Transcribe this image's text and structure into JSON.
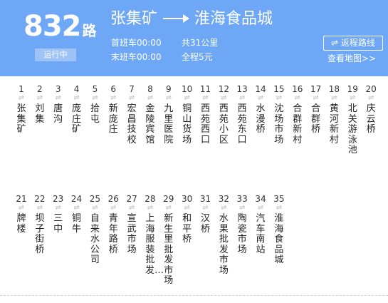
{
  "route": {
    "number": "832",
    "suffix": "路",
    "status": "运行中"
  },
  "title": {
    "from": "张集矿",
    "to": "淮海食品城"
  },
  "info": {
    "first_bus": "首班车00:00",
    "last_bus": "末班车00:00",
    "distance": "共31公里",
    "fare": "全程5元"
  },
  "actions": {
    "return_route": "⇌ 返程路线",
    "view_map": "查看地图>>"
  },
  "stops": [
    {
      "num": "1",
      "name": "张集矿"
    },
    {
      "num": "2",
      "name": "刘集"
    },
    {
      "num": "3",
      "name": "唐沟"
    },
    {
      "num": "4",
      "name": "庞庄矿"
    },
    {
      "num": "5",
      "name": "拾屯"
    },
    {
      "num": "6",
      "name": "新庞庄"
    },
    {
      "num": "7",
      "name": "宏昌技校"
    },
    {
      "num": "8",
      "name": "金陵宾馆"
    },
    {
      "num": "9",
      "name": "九里医院"
    },
    {
      "num": "10",
      "name": "铜山货场"
    },
    {
      "num": "11",
      "name": "西苑西口"
    },
    {
      "num": "12",
      "name": "西苑小区"
    },
    {
      "num": "13",
      "name": "西苑东口"
    },
    {
      "num": "14",
      "name": "水漫桥"
    },
    {
      "num": "15",
      "name": "沈场市场"
    },
    {
      "num": "16",
      "name": "合群新村"
    },
    {
      "num": "17",
      "name": "合群桥"
    },
    {
      "num": "18",
      "name": "黄河新村"
    },
    {
      "num": "19",
      "name": "北关游泳池"
    },
    {
      "num": "20",
      "name": "庆云桥"
    },
    {
      "num": "21",
      "name": "牌楼"
    },
    {
      "num": "22",
      "name": "坝子街桥"
    },
    {
      "num": "23",
      "name": "三中"
    },
    {
      "num": "24",
      "name": "铜牛"
    },
    {
      "num": "25",
      "name": "自来水公司"
    },
    {
      "num": "26",
      "name": "青年路桥"
    },
    {
      "num": "27",
      "name": "宣武市场"
    },
    {
      "num": "28",
      "name": "上海服装批发…"
    },
    {
      "num": "29",
      "name": "新生里批发市场"
    },
    {
      "num": "30",
      "name": "和平桥"
    },
    {
      "num": "31",
      "name": "汉桥"
    },
    {
      "num": "32",
      "name": "水果批发市场"
    },
    {
      "num": "33",
      "name": "陶瓷市场"
    },
    {
      "num": "34",
      "name": "汽车南站"
    },
    {
      "num": "35",
      "name": "淮海食品城"
    }
  ]
}
